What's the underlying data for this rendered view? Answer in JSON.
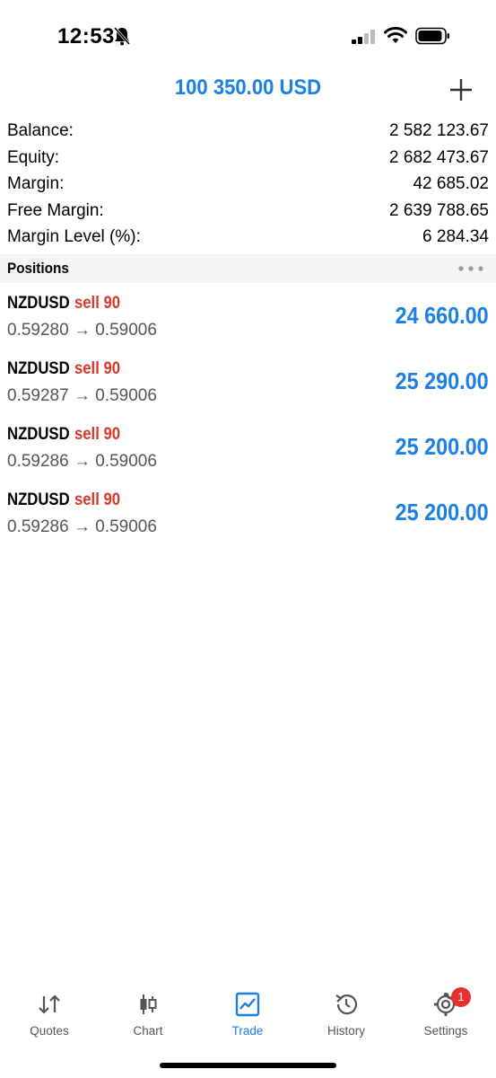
{
  "status_bar": {
    "time": "12:53"
  },
  "header": {
    "title": "100 350.00 USD"
  },
  "summary": [
    {
      "label": "Balance:",
      "value": "2 582 123.67"
    },
    {
      "label": "Equity:",
      "value": "2 682 473.67"
    },
    {
      "label": "Margin:",
      "value": "42 685.02"
    },
    {
      "label": "Free Margin:",
      "value": "2 639 788.65"
    },
    {
      "label": "Margin Level (%):",
      "value": "6 284.34"
    }
  ],
  "positions_section": {
    "title": "Positions"
  },
  "positions": [
    {
      "symbol": "NZDUSD",
      "type": "sell 90",
      "prices": "0.59280 → 0.59006",
      "profit": "24 660.00"
    },
    {
      "symbol": "NZDUSD",
      "type": "sell 90",
      "prices": "0.59287 → 0.59006",
      "profit": "25 290.00"
    },
    {
      "symbol": "NZDUSD",
      "type": "sell 90",
      "prices": "0.59286 → 0.59006",
      "profit": "25 200.00"
    },
    {
      "symbol": "NZDUSD",
      "type": "sell 90",
      "prices": "0.59286 → 0.59006",
      "profit": "25 200.00"
    }
  ],
  "tabs": [
    {
      "label": "Quotes",
      "icon": "quotes-arrows-icon",
      "active": false
    },
    {
      "label": "Chart",
      "icon": "candlestick-icon",
      "active": false
    },
    {
      "label": "Trade",
      "icon": "trade-chart-icon",
      "active": true
    },
    {
      "label": "History",
      "icon": "history-clock-icon",
      "active": false
    },
    {
      "label": "Settings",
      "icon": "gear-icon",
      "active": false,
      "badge": "1"
    }
  ],
  "colors": {
    "accent": "#1a7fe6",
    "sell": "#d9372b",
    "badge": "#e8312a"
  }
}
